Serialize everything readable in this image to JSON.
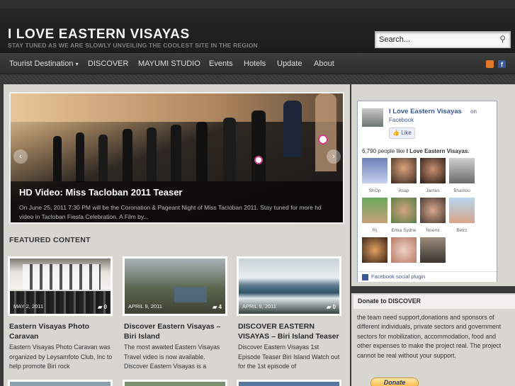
{
  "header": {
    "site_title": "I LOVE EASTERN VISAYAS",
    "tagline": "STAY TUNED AS WE ARE SLOWLY UNVEILING THE COOLEST SITE IN THE REGION",
    "search_placeholder": "Search..."
  },
  "nav": {
    "items": [
      "Tourist Destination",
      "DISCOVER",
      "MAYUMI STUDIO",
      "Events",
      "Hotels",
      "Update",
      "About"
    ],
    "dropdown_arrow": "▾",
    "icons": [
      "rss-icon",
      "facebook-icon"
    ]
  },
  "slider": {
    "title": "HD Video: Miss Tacloban 2011 Teaser",
    "text": "On June 25, 2011 7:30 PM will be the Coronation & Pageant Night of Miss Tacloban 2011. Stay tuned for more hd video in Tacloban Fiesta Celebration. A Film by...",
    "prev": "‹",
    "next": "›"
  },
  "featured": {
    "heading": "FEATURED CONTENT",
    "cards": [
      {
        "date": "MAY 2, 2011",
        "comments": "0",
        "title": "Eastern Visayas Photo Caravan",
        "excerpt": "Eastern Visayas Photo Caravan was organized by Leysamfoto Club, Inc to help promote Biri rock"
      },
      {
        "date": "APRIL 9, 2011",
        "comments": "4",
        "title": "Discover Eastern Visayas – Biri Island",
        "excerpt": "The most awaited Eastern Visayas Travel video is now available. Discover Eastern Visayas is a"
      },
      {
        "date": "APRIL 9, 2011",
        "comments": "0",
        "title": "DISCOVER EASTERN VISAYAS – Biri Island Teaser",
        "excerpt": "Discover Eastern Visayas 1st Episode Teaser Biri Island  Watch out for the 1st episode of"
      }
    ]
  },
  "facebook": {
    "page_name": "I Love Eastern Visayas",
    "on": "on",
    "facebook_word": "Facebook",
    "like_label": "Like",
    "count_prefix": "6,790 people like",
    "count_page": "I Love Eastern Visayas.",
    "fans": [
      "ShOp",
      "Asap",
      "James",
      "Sharilou",
      "Rj",
      "Erika Sydne",
      "Noemi",
      "Betrz",
      "",
      "",
      ""
    ],
    "plugin_label": "Facebook social plugin"
  },
  "donate": {
    "title": "Donate to DISCOVER",
    "text": "the team need support,donations and sponsors of different individuals, private sectors and government sectors for mobilization, accommodation, food and other expenses to make the project real. The project cannot be real without your support.",
    "button_label": "Donate"
  },
  "colors": {
    "header_bg": "#1c1c1c",
    "nav_bg": "#333331",
    "content_bg": "#d8d6d0",
    "facebook_blue": "#3b5998"
  }
}
